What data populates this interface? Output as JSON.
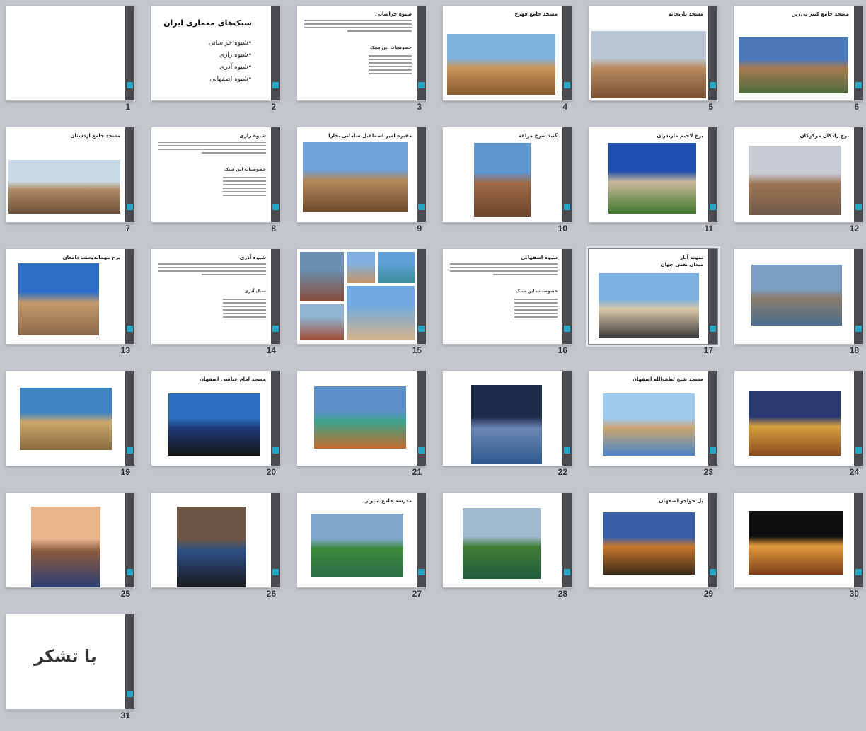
{
  "slides": [
    {
      "num": "1",
      "kind": "logo"
    },
    {
      "num": "2",
      "kind": "list",
      "title": "سبک‌های معماری ایران",
      "items": [
        "شیوه خراسانی",
        "شیوه رازی",
        "شیوه آذری",
        "شیوه اصفهانی"
      ]
    },
    {
      "num": "3",
      "kind": "text",
      "title": "شیوه خراسانی",
      "subtitle": "خصوصیات این سبک"
    },
    {
      "num": "4",
      "kind": "photo",
      "title": "مسجد جامع فهرج",
      "palette": [
        "#7fb3e0",
        "#c9955c",
        "#8a5a30"
      ]
    },
    {
      "num": "5",
      "kind": "photo",
      "title": "مسجد تاریخانه",
      "palette": [
        "#b9c7d6",
        "#b98a5e",
        "#7a5134"
      ]
    },
    {
      "num": "6",
      "kind": "photo",
      "title": "مسجد جامع کبیر نی‌ریز",
      "palette": [
        "#4a78b8",
        "#a87b52",
        "#4e6a3c"
      ]
    },
    {
      "num": "7",
      "kind": "photo",
      "title": "مسجد جامع اردستان",
      "palette": [
        "#c8d8e6",
        "#b08b66",
        "#6c5039"
      ]
    },
    {
      "num": "8",
      "kind": "text",
      "title": "شیوه رازی",
      "subtitle": "خصوصیات این سبک"
    },
    {
      "num": "9",
      "kind": "photo",
      "title": "مقبره امیر اسماعیل سامانی بخارا",
      "palette": [
        "#6fa3d8",
        "#b38759",
        "#6d4b2d"
      ]
    },
    {
      "num": "10",
      "kind": "photo",
      "title": "گنبد سرخ مراغه",
      "palette": [
        "#5f95cf",
        "#a06b46",
        "#6e452c"
      ]
    },
    {
      "num": "11",
      "kind": "photo",
      "title": "برج لاجیم مازندران",
      "palette": [
        "#1f4fb0",
        "#c9b79a",
        "#3f7a2c"
      ]
    },
    {
      "num": "12",
      "kind": "photo",
      "title": "برج رادکان مرکزکان",
      "palette": [
        "#c7ccd3",
        "#9c7554",
        "#6f5a48"
      ]
    },
    {
      "num": "13",
      "kind": "photo",
      "title": "برج مهماندوست دامغان",
      "palette": [
        "#2f6fc7",
        "#c59a6b",
        "#8b6847"
      ]
    },
    {
      "num": "14",
      "kind": "text",
      "title": "شیوه آذری",
      "subtitle": "سبک آذری"
    },
    {
      "num": "15",
      "kind": "collage"
    },
    {
      "num": "16",
      "kind": "text",
      "title": "شیوه اصفهانی",
      "subtitle": "خصوصیات این سبک"
    },
    {
      "num": "17",
      "kind": "photo",
      "title": "میدان نقش جهان",
      "title2": "نمونه آثار",
      "palette": [
        "#7bb0e0",
        "#d9c7a8",
        "#3a3a3a"
      ]
    },
    {
      "num": "18",
      "kind": "photo",
      "title": "",
      "palette": [
        "#7a9ec6",
        "#8b7d6c",
        "#4a6d8b"
      ]
    },
    {
      "num": "19",
      "kind": "photo",
      "title": "",
      "palette": [
        "#3e86c2",
        "#c9a76b",
        "#8a6b3f"
      ]
    },
    {
      "num": "20",
      "kind": "photo",
      "title": "مسجد امام عباسی اصفهان",
      "palette": [
        "#2b6fc0",
        "#1f3b7a",
        "#141414"
      ]
    },
    {
      "num": "21",
      "kind": "photo",
      "title": "",
      "palette": [
        "#5d8fc9",
        "#3aa38f",
        "#c16d2c"
      ]
    },
    {
      "num": "22",
      "kind": "photo",
      "title": "",
      "palette": [
        "#1c2b4a",
        "#6b86b4",
        "#2d5a8c"
      ]
    },
    {
      "num": "23",
      "kind": "photo",
      "title": "مسجد شیخ لطف‌الله اصفهان",
      "palette": [
        "#9fc9ef",
        "#caa56f",
        "#4a86c8"
      ]
    },
    {
      "num": "24",
      "kind": "photo",
      "title": "",
      "palette": [
        "#2c3a73",
        "#d5a13d",
        "#8a4b1d"
      ]
    },
    {
      "num": "25",
      "kind": "photo",
      "title": "",
      "palette": [
        "#e7b48b",
        "#8c5a3e",
        "#2b3f73"
      ]
    },
    {
      "num": "26",
      "kind": "photo",
      "title": "",
      "palette": [
        "#6b5744",
        "#2c4f86",
        "#1a1a1a"
      ]
    },
    {
      "num": "27",
      "kind": "photo",
      "title": "مدرسه جامع شیراز",
      "palette": [
        "#7ea6c9",
        "#3d8a3a",
        "#2c6e4a"
      ]
    },
    {
      "num": "28",
      "kind": "photo",
      "title": "",
      "palette": [
        "#9fb8cf",
        "#3f7d34",
        "#1f5d3f"
      ]
    },
    {
      "num": "29",
      "kind": "photo",
      "title": "پل خواجو اصفهان",
      "palette": [
        "#3a5fa8",
        "#c9782d",
        "#3b2a1a"
      ]
    },
    {
      "num": "30",
      "kind": "photo",
      "title": "",
      "palette": [
        "#0f0f0f",
        "#e39a3d",
        "#7a3f18"
      ]
    },
    {
      "num": "31",
      "kind": "thanks",
      "text": "با تشکر"
    }
  ],
  "selected_slide": "17"
}
